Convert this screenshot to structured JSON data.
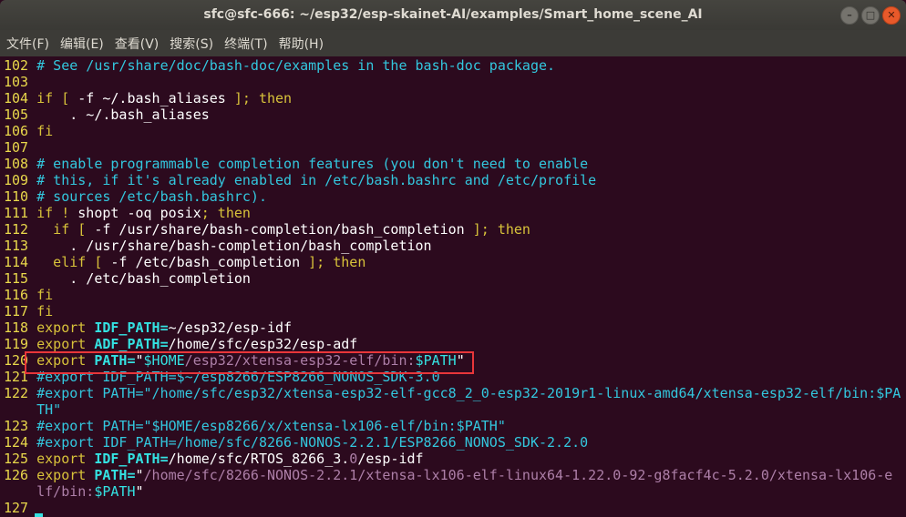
{
  "window": {
    "title": "sfc@sfc-666: ~/esp32/esp-skainet-AI/examples/Smart_home_scene_AI",
    "buttons": [
      "minimize",
      "maximize",
      "close"
    ]
  },
  "menu": [
    "文件(F)",
    "编辑(E)",
    "查看(V)",
    "搜索(S)",
    "终端(T)",
    "帮助(H)"
  ],
  "colors": {
    "background": "#2c0a1e",
    "line_number": "#e9d84b",
    "keyword": "#d8c23a",
    "comment": "#33c7de",
    "identifier": "#34e2e2",
    "string": "#ad7fa8",
    "highlight_box": "#e8363a"
  },
  "lines": [
    {
      "num": "102",
      "segs": [
        [
          "c",
          "# See /usr/share/doc/bash-doc/examples in the bash-doc package."
        ]
      ]
    },
    {
      "num": "103",
      "segs": []
    },
    {
      "num": "104",
      "segs": [
        [
          "k",
          "if [ "
        ],
        [
          "n",
          "-f ~/.bash_aliases "
        ],
        [
          "k",
          "]; then"
        ]
      ]
    },
    {
      "num": "105",
      "segs": [
        [
          "n",
          "    . ~/.bash_aliases"
        ]
      ]
    },
    {
      "num": "106",
      "segs": [
        [
          "k",
          "fi"
        ]
      ]
    },
    {
      "num": "107",
      "segs": []
    },
    {
      "num": "108",
      "segs": [
        [
          "c",
          "# enable programmable completion features (you don't need to enable"
        ]
      ]
    },
    {
      "num": "109",
      "segs": [
        [
          "c",
          "# this, if it's already enabled in /etc/bash.bashrc and /etc/profile"
        ]
      ]
    },
    {
      "num": "110",
      "segs": [
        [
          "c",
          "# sources /etc/bash.bashrc)."
        ]
      ]
    },
    {
      "num": "111",
      "segs": [
        [
          "k",
          "if ! "
        ],
        [
          "n",
          "shopt -oq posix"
        ],
        [
          "k",
          "; then"
        ]
      ]
    },
    {
      "num": "112",
      "segs": [
        [
          "k",
          "  if [ "
        ],
        [
          "n",
          "-f /usr/share/bash-completion/bash_completion "
        ],
        [
          "k",
          "]; then"
        ]
      ]
    },
    {
      "num": "113",
      "segs": [
        [
          "n",
          "    . /usr/share/bash-completion/bash_completion"
        ]
      ]
    },
    {
      "num": "114",
      "segs": [
        [
          "k",
          "  elif [ "
        ],
        [
          "n",
          "-f /etc/bash_completion "
        ],
        [
          "k",
          "]; then"
        ]
      ]
    },
    {
      "num": "115",
      "segs": [
        [
          "n",
          "    . /etc/bash_completion"
        ]
      ]
    },
    {
      "num": "116",
      "segs": [
        [
          "k",
          "fi"
        ]
      ]
    },
    {
      "num": "117",
      "segs": [
        [
          "k",
          "fi"
        ]
      ]
    },
    {
      "num": "118",
      "segs": [
        [
          "k",
          "export "
        ],
        [
          "v",
          "IDF_PATH="
        ],
        [
          "n",
          "~/esp32/esp-idf"
        ]
      ]
    },
    {
      "num": "119",
      "segs": [
        [
          "k",
          "export "
        ],
        [
          "v",
          "ADF_PATH="
        ],
        [
          "n",
          "/home/sfc/esp32/esp-adf"
        ]
      ]
    },
    {
      "num": "120",
      "segs": [
        [
          "k",
          "export "
        ],
        [
          "v",
          "PATH="
        ],
        [
          "n",
          "\""
        ],
        [
          "d",
          "$HOME"
        ],
        [
          "s",
          "/esp32/xtensa-esp32-elf/bin:"
        ],
        [
          "d",
          "$PATH"
        ],
        [
          "n",
          "\""
        ]
      ]
    },
    {
      "num": "121",
      "segs": [
        [
          "c",
          "#export IDF_PATH=$~/esp8266/ESP8266_NONOS_SDK-3.0"
        ]
      ]
    },
    {
      "num": "122",
      "segs": [
        [
          "c",
          "#export PATH=\"/home/sfc/esp32/xtensa-esp32-elf-gcc8_2_0-esp32-2019r1-linux-amd64/xtensa-esp32-elf/bin:$PATH\""
        ]
      ]
    },
    {
      "num": "123",
      "segs": [
        [
          "c",
          "#export PATH=\"$HOME/esp8266/x/xtensa-lx106-elf/bin:$PATH\""
        ]
      ]
    },
    {
      "num": "124",
      "segs": [
        [
          "c",
          "#export IDF_PATH=/home/sfc/8266-NONOS-2.2.1/ESP8266_NONOS_SDK-2.2.0"
        ]
      ]
    },
    {
      "num": "125",
      "segs": [
        [
          "k",
          "export "
        ],
        [
          "v",
          "IDF_PATH="
        ],
        [
          "n",
          "/home/sfc/RTOS_8266_3."
        ],
        [
          "s",
          "0"
        ],
        [
          "n",
          "/esp-idf"
        ]
      ]
    },
    {
      "num": "126",
      "segs": [
        [
          "k",
          "export "
        ],
        [
          "v",
          "PATH="
        ],
        [
          "n",
          "\""
        ],
        [
          "s",
          "/home/sfc/8266-NONOS-2.2.1/xtensa-lx106-elf-linux64-1.22.0-92-g8facf4c-5.2.0/xtensa-lx106-elf/bin:"
        ],
        [
          "d",
          "$PATH"
        ],
        [
          "n",
          "\""
        ]
      ]
    },
    {
      "num": "127",
      "segs": []
    }
  ]
}
